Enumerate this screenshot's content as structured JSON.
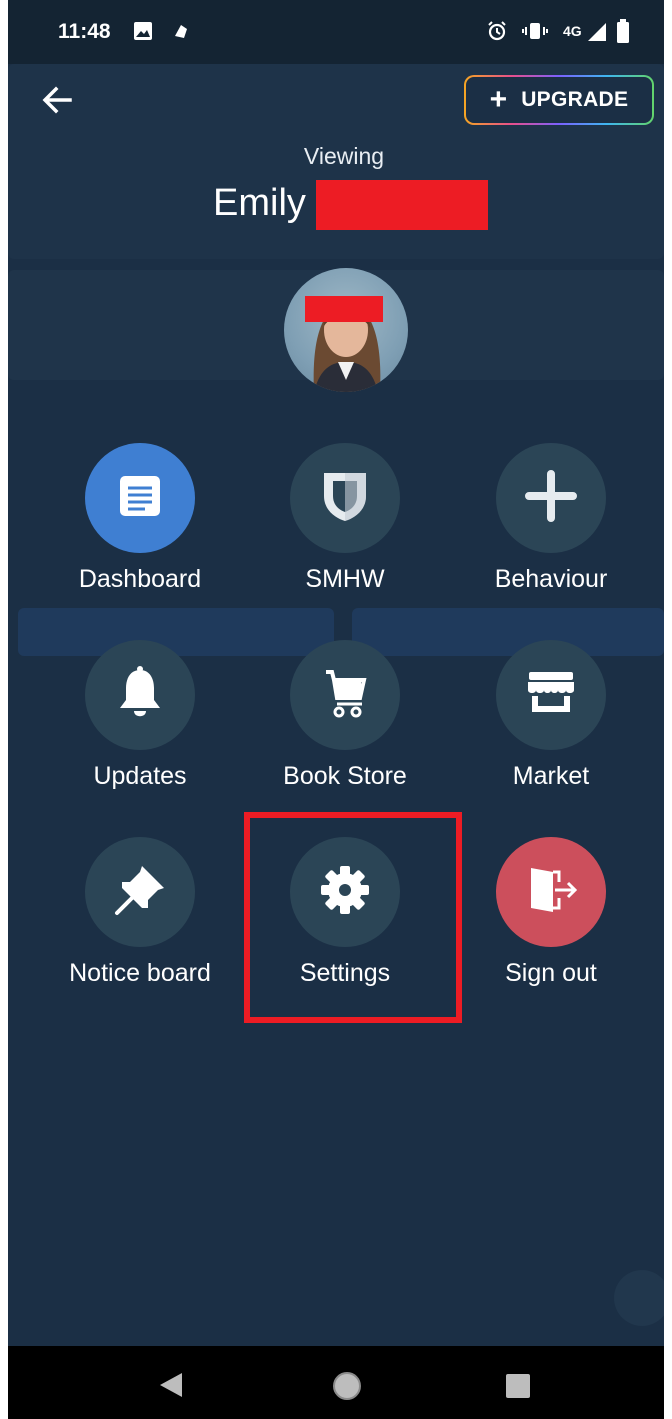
{
  "status_bar": {
    "time": "11:48",
    "network": "4G",
    "left_icons": [
      "image-icon",
      "app-notification-icon"
    ],
    "right_icons": [
      "alarm-icon",
      "vibrate-icon",
      "signal-icon",
      "battery-icon"
    ]
  },
  "header": {
    "back_icon": "arrow-left-icon",
    "upgrade_label": "UPGRADE",
    "viewing_label": "Viewing",
    "student_name": "Emily"
  },
  "menu": {
    "items": [
      {
        "label": "Dashboard",
        "icon": "document-icon",
        "color": "#3f7fd2"
      },
      {
        "label": "SMHW",
        "icon": "shield-icon",
        "color": "#2b4556"
      },
      {
        "label": "Behaviour",
        "icon": "plus-icon",
        "color": "#2b4556"
      },
      {
        "label": "Updates",
        "icon": "bell-icon",
        "color": "#2b4556"
      },
      {
        "label": "Book Store",
        "icon": "cart-icon",
        "color": "#2b4556"
      },
      {
        "label": "Market",
        "icon": "storefront-icon",
        "color": "#2b4556"
      },
      {
        "label": "Notice board",
        "icon": "pin-icon",
        "color": "#2b4556"
      },
      {
        "label": "Settings",
        "icon": "gear-icon",
        "color": "#2b4556"
      },
      {
        "label": "Sign out",
        "icon": "exit-door-icon",
        "color": "#cc4f5c"
      }
    ]
  },
  "colors": {
    "background": "#1b2f45",
    "tile": "#2b4556",
    "accent_blue": "#3f7fd2",
    "sign_out_red": "#cc4f5c",
    "highlight_red": "#ed1c24"
  },
  "nav_bar": {
    "icons": [
      "back-triangle-icon",
      "home-circle-icon",
      "recents-square-icon"
    ]
  }
}
